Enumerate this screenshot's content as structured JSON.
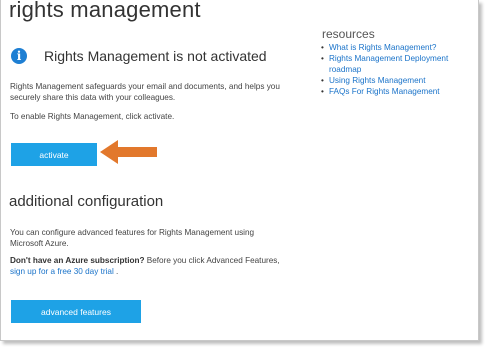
{
  "page": {
    "title": "rights management"
  },
  "notice": {
    "title": "Rights Management is not activated",
    "description": "Rights Management safeguards your email and documents, and helps you securely share this data with your colleagues.",
    "instruction": "To enable Rights Management, click activate.",
    "activate_label": "activate"
  },
  "additional": {
    "title": "additional configuration",
    "description": "You can configure advanced features for Rights Management using Microsoft Azure.",
    "subscription_bold": "Don't have an Azure subscription?",
    "subscription_text": " Before you click Advanced Features, ",
    "trial_link": "sign up for a free 30 day trial",
    "trial_suffix": " .",
    "advanced_label": "advanced features"
  },
  "resources": {
    "title": "resources",
    "links": [
      "What is Rights Management?",
      "Rights Management Deployment roadmap",
      "Using Rights Management",
      "FAQs For Rights Management"
    ]
  },
  "colors": {
    "button": "#1ea2e6",
    "link": "#1a73c9",
    "arrow": "#e2782c",
    "info_icon": "#1e7fd3"
  },
  "icons": {
    "info": "info-icon",
    "arrow": "arrow-left-icon"
  }
}
